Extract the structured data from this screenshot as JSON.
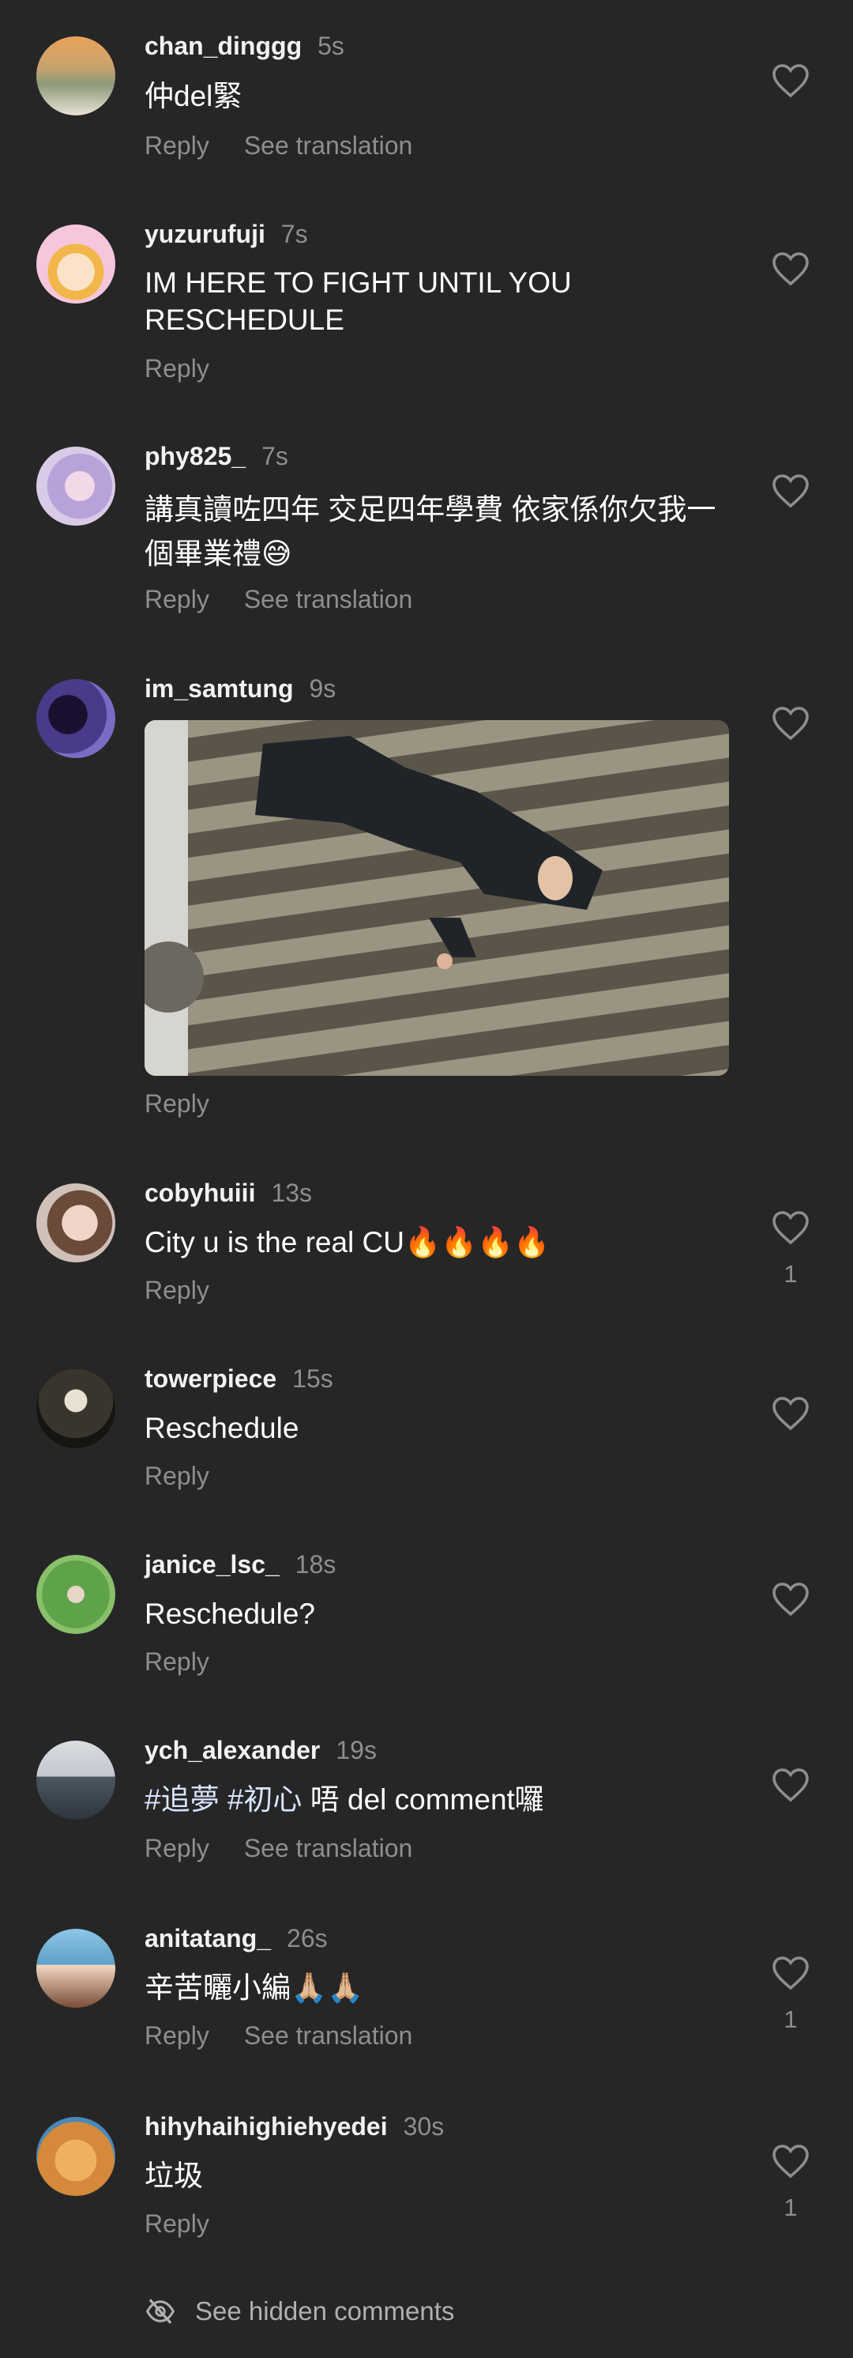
{
  "comments": [
    {
      "username": "chan_dinggg",
      "time": "5s",
      "text": "仲del緊",
      "reply": "Reply",
      "translate": "See translation"
    },
    {
      "username": "yuzurufuji",
      "time": "7s",
      "text": "IM HERE TO FIGHT UNTIL YOU RESCHEDULE",
      "reply": "Reply"
    },
    {
      "username": "phy825_",
      "time": "7s",
      "text": "講真讀咗四年 交足四年學費 依家係你欠我一個畢業禮😅",
      "reply": "Reply",
      "translate": "See translation"
    },
    {
      "username": "im_samtung",
      "time": "9s",
      "reply": "Reply"
    },
    {
      "username": "cobyhuiii",
      "time": "13s",
      "text": "City u is the real CU🔥🔥🔥🔥",
      "reply": "Reply",
      "likes": "1"
    },
    {
      "username": "towerpiece",
      "time": "15s",
      "text": "Reschedule",
      "reply": "Reply"
    },
    {
      "username": "janice_lsc_",
      "time": "18s",
      "text": "Reschedule?",
      "reply": "Reply"
    },
    {
      "username": "ych_alexander",
      "time": "19s",
      "text": "#追夢 #初心 唔 del comment囉",
      "reply": "Reply",
      "translate": "See translation"
    },
    {
      "username": "anitatang_",
      "time": "26s",
      "text": "辛苦曬小編🙏🏼🙏🏼",
      "reply": "Reply",
      "translate": "See translation",
      "likes": "1"
    },
    {
      "username": "hihyhaihighiehyedei",
      "time": "30s",
      "text": "垃圾",
      "reply": "Reply",
      "likes": "1"
    }
  ],
  "footer": {
    "hidden_label": "See hidden comments"
  },
  "icons": {
    "like": "heart-outline-icon",
    "hidden": "eye-off-icon"
  },
  "colors": {
    "background": "#262626",
    "secondary_text": "#8e8e8e",
    "primary_text": "#ffffff"
  }
}
